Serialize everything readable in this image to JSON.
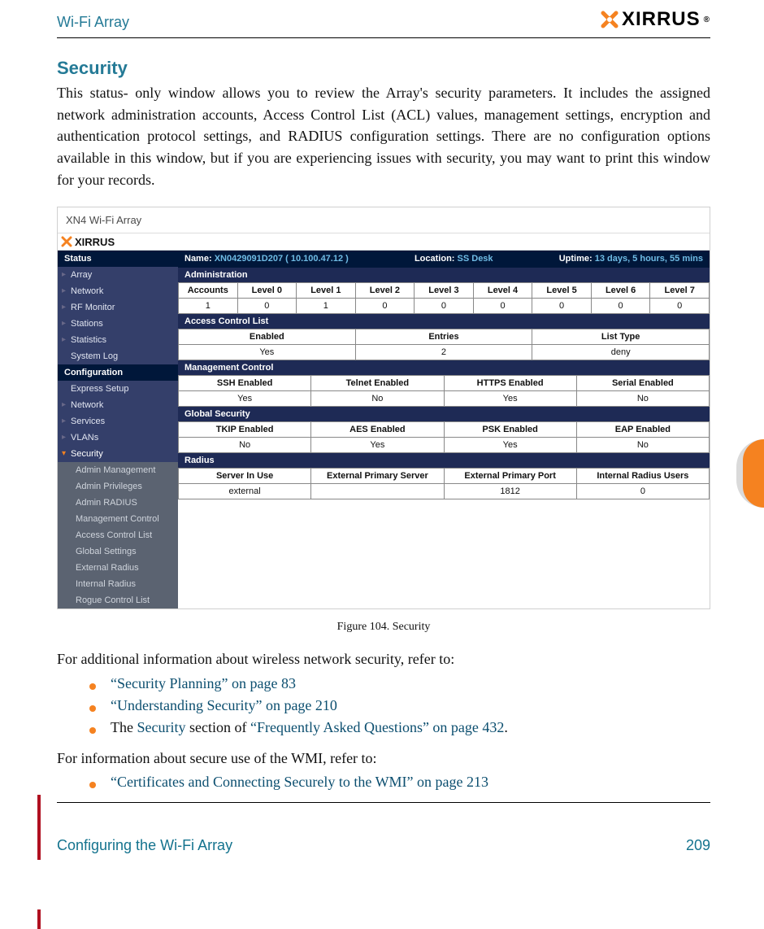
{
  "header": {
    "title": "Wi-Fi Array",
    "brand": "XIRRUS"
  },
  "section": {
    "heading": "Security",
    "intro": "This status- only window allows you to review the Array's security parameters. It includes the assigned network administration accounts, Access Control List (ACL) values, management settings, encryption and authentication protocol settings, and RADIUS configuration settings. There are no configuration options available in this window, but if you are experiencing issues with security, you may want to print this window for your records."
  },
  "screenshot": {
    "window_title": "XN4 Wi-Fi Array",
    "topbar": {
      "name_label": "Name:",
      "name_value": "XN0429091D207   ( 10.100.47.12 )",
      "location_label": "Location:",
      "location_value": "SS Desk",
      "uptime_label": "Uptime:",
      "uptime_value": "13 days, 5 hours, 55 mins"
    },
    "nav": {
      "status_header": "Status",
      "status_items": [
        "Array",
        "Network",
        "RF Monitor",
        "Stations",
        "Statistics",
        "System Log"
      ],
      "config_header": "Configuration",
      "config_items": [
        "Express Setup",
        "Network",
        "Services",
        "VLANs"
      ],
      "security_item": "Security",
      "security_subitems": [
        "Admin Management",
        "Admin Privileges",
        "Admin RADIUS",
        "Management Control",
        "Access Control List",
        "Global Settings",
        "External Radius",
        "Internal Radius",
        "Rogue Control List"
      ]
    },
    "admin": {
      "title": "Administration",
      "cols": [
        "Accounts",
        "Level 0",
        "Level 1",
        "Level 2",
        "Level 3",
        "Level 4",
        "Level 5",
        "Level 6",
        "Level 7"
      ],
      "row": [
        "1",
        "0",
        "1",
        "0",
        "0",
        "0",
        "0",
        "0",
        "0"
      ]
    },
    "acl": {
      "title": "Access Control List",
      "cols": [
        "Enabled",
        "Entries",
        "List Type"
      ],
      "row": [
        "Yes",
        "2",
        "deny"
      ]
    },
    "mgmt": {
      "title": "Management Control",
      "cols": [
        "SSH Enabled",
        "Telnet Enabled",
        "HTTPS Enabled",
        "Serial Enabled"
      ],
      "row": [
        "Yes",
        "No",
        "Yes",
        "No"
      ]
    },
    "gsec": {
      "title": "Global Security",
      "cols": [
        "TKIP Enabled",
        "AES Enabled",
        "PSK Enabled",
        "EAP Enabled"
      ],
      "row": [
        "No",
        "Yes",
        "Yes",
        "No"
      ]
    },
    "radius": {
      "title": "Radius",
      "cols": [
        "Server In Use",
        "External Primary Server",
        "External Primary Port",
        "Internal Radius Users"
      ],
      "row": [
        "external",
        "",
        "1812",
        "0"
      ]
    }
  },
  "figure_caption": "Figure 104. Security",
  "post": {
    "p1": "For additional information about wireless network security, refer to:",
    "b1": "“Security Planning” on page 83",
    "b2": "“Understanding Security” on page 210",
    "b3_pre": "The ",
    "b3_link1": "Security",
    "b3_mid": " section of ",
    "b3_link2": "“Frequently Asked Questions” on page 432",
    "b3_post": ".",
    "p2": "For information about secure use of the WMI, refer to:",
    "b4": "“Certificates and Connecting Securely to the WMI” on page 213"
  },
  "footer": {
    "left": "Configuring the Wi-Fi Array",
    "right": "209"
  }
}
